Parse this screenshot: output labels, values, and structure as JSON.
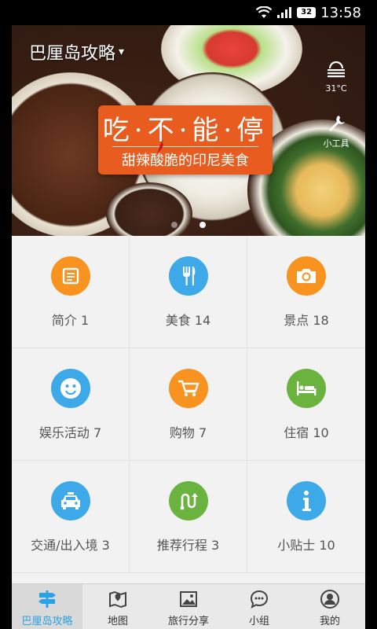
{
  "status_bar": {
    "battery": "32",
    "time": "13:58"
  },
  "header": {
    "title": "巴厘岛攻略",
    "chevron": "▾"
  },
  "weather": {
    "temperature": "31°C",
    "icon": "fog-icon"
  },
  "tools": {
    "label": "小工具",
    "icon": "wrench-icon"
  },
  "banner": {
    "title": "吃·不·能·停",
    "subtitle": "甜辣酸脆的印尼美食",
    "dots_count": 2,
    "active_dot": 1
  },
  "grid": [
    {
      "label": "简介 1",
      "icon": "document-icon",
      "color": "#f7931e"
    },
    {
      "label": "美食 14",
      "icon": "fork-knife-icon",
      "color": "#3ea9e8"
    },
    {
      "label": "景点 18",
      "icon": "camera-icon",
      "color": "#f7931e"
    },
    {
      "label": "娱乐活动 7",
      "icon": "smiley-icon",
      "color": "#3ea9e8"
    },
    {
      "label": "购物 7",
      "icon": "cart-icon",
      "color": "#f7931e"
    },
    {
      "label": "住宿 10",
      "icon": "bed-icon",
      "color": "#6ab33e"
    },
    {
      "label": "交通/出入境 3",
      "icon": "taxi-icon",
      "color": "#3ea9e8"
    },
    {
      "label": "推荐行程 3",
      "icon": "route-icon",
      "color": "#6ab33e"
    },
    {
      "label": "小贴士 10",
      "icon": "info-icon",
      "color": "#3ea9e8"
    }
  ],
  "tabs": [
    {
      "label": "巴厘岛攻略",
      "icon": "signpost-icon",
      "active": true
    },
    {
      "label": "地图",
      "icon": "map-icon",
      "active": false
    },
    {
      "label": "旅行分享",
      "icon": "picture-icon",
      "active": false
    },
    {
      "label": "小组",
      "icon": "chat-icon",
      "active": false
    },
    {
      "label": "我的",
      "icon": "user-icon",
      "active": false
    }
  ],
  "colors": {
    "accent": "#2aa3e4",
    "orange": "#f7931e",
    "blue": "#3ea9e8",
    "green": "#6ab33e",
    "promo": "#e85d1f"
  }
}
